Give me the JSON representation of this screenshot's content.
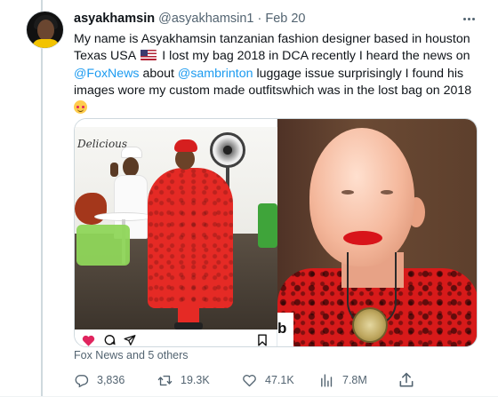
{
  "tweet": {
    "author_name": "asyakhamsin",
    "handle": "@asyakhamsin1",
    "separator": "·",
    "date": "Feb 20",
    "text": {
      "l1": "My name is Asyakhamsin tanzanian fashion designer  based in houston",
      "l2a": "Texas USA",
      "l2b": "I lost my bag 2018 in DCA  recently I heard the news on",
      "mention_foxnews": "@FoxNews",
      "l3b": " about ",
      "mention_sambrinton": "@sambrinton",
      "l3d": " luggage issue surprisingly I found his",
      "l4": "images wore my custom made outfitswhich  was in the lost bag on 2018"
    }
  },
  "media": {
    "post_sign": "Delicious",
    "right_logo_text": "b"
  },
  "liked_by": "Fox News and 5 others",
  "actions": {
    "replies": "3,836",
    "reposts": "19.3K",
    "likes": "47.1K",
    "views": "7.8M"
  },
  "icons": {
    "more": "more-horizontal-icon",
    "flag": "us-flag-emoji-icon",
    "smile": "smiling-face-emoji-icon",
    "reply": "reply-icon",
    "repost": "repost-icon",
    "like": "like-icon",
    "views": "views-icon",
    "share": "share-icon"
  },
  "colors": {
    "link": "#1d9bf0",
    "text": "#0f1419",
    "secondary": "#536471",
    "heart": "#e0245e"
  }
}
